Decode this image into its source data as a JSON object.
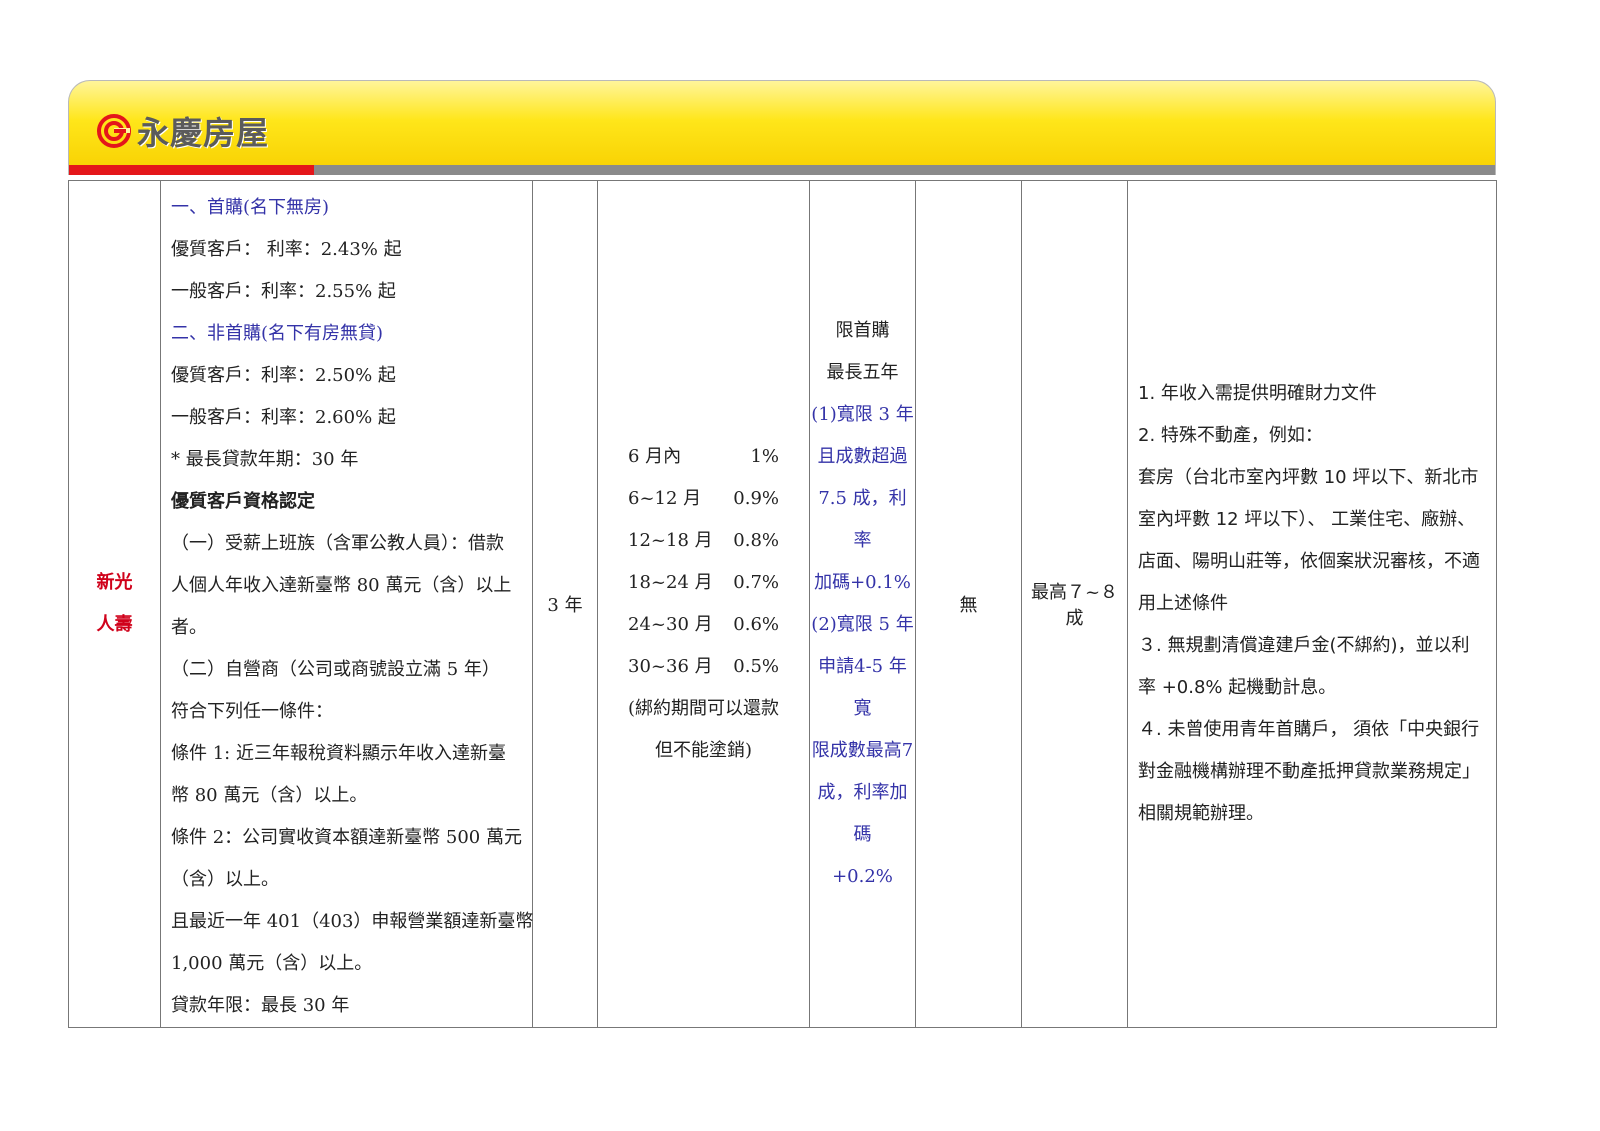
{
  "brand": {
    "name": "永慶房屋"
  },
  "table": {
    "company": [
      "新光",
      "人壽"
    ],
    "rate": {
      "first_title": "一、首購(名下無房)",
      "first_premium": "優質客戶： 利率：2.43% 起",
      "first_general": "一般客戶：利率：2.55% 起",
      "second_title": "二、非首購(名下有房無貸)",
      "second_premium": "優質客戶：利率：2.50% 起",
      "second_general": "一般客戶：利率：2.60% 起",
      "max_term": "* 最長貸款年期：30 年",
      "qual_title": "優質客戶資格認定",
      "q1_line1": "（一）受薪上班族（含軍公教人員）：借款",
      "q1_line2": "人個人年收入達新臺幣 80 萬元（含）以上",
      "q1_line3": "者。",
      "q2_line1": "（二）自營商（公司或商號設立滿 5 年）",
      "q2_line2": "符合下列任一條件：",
      "c1_line1": "條件 1: 近三年報稅資料顯示年收入達新臺",
      "c1_line2": "幣 80 萬元（含）以上。",
      "c2_line1": "條件 2：公司實收資本額達新臺幣 500 萬元",
      "c2_line2": "（含）以上。",
      "c3_line1": "且最近一年 401（403）申報營業額達新臺幣",
      "c3_line2": "1,000 萬元（含）以上。",
      "term": "貸款年限：最長 30 年"
    },
    "lock_period": "3 年",
    "penalty": {
      "rows": [
        {
          "period": "6 月內",
          "rate": "1%"
        },
        {
          "period": "6~12 月",
          "rate": "0.9%"
        },
        {
          "period": "12~18 月",
          "rate": "0.8%"
        },
        {
          "period": "18~24 月",
          "rate": "0.7%"
        },
        {
          "period": "24~30 月",
          "rate": "0.6%"
        },
        {
          "period": "30~36 月",
          "rate": "0.5%"
        }
      ],
      "note1": "(綁約期間可以還款",
      "note2": "但不能塗銷)"
    },
    "grace": {
      "l1": "限首購",
      "l2": "最長五年",
      "l3": "(1)寬限 3 年",
      "l4": "且成數超過",
      "l5": "7.5 成，利率",
      "l6": "加碼+0.1%",
      "l7": "(2)寬限 5 年",
      "l8": "申請4-5 年寬",
      "l9": "限成數最高7",
      "l10": "成，利率加碼",
      "l11": "+0.2%"
    },
    "fee": "無",
    "ltv": "最高７~８成",
    "notes": {
      "n1": "1. 年收入需提供明確財力文件",
      "n2": "2. 特殊不動產，例如：",
      "n3": "套房（台北市室內坪數 10 坪以下、新北市室內坪數 12 坪以下）、 工業住宅、廠辦、店面、陽明山莊等，依個案狀況審核，不適用上述條件",
      "n4": "３. 無規劃清償違建戶金(不綁約)，並以利率 +0.8% 起機動計息。",
      "n5": "４. 未曾使用青年首購戶， 須依「中央銀行對金融機構辦理不動產抵押貸款業務規定」相關規範辦理。"
    }
  },
  "colors": {
    "header_yellow": "#ffe61a",
    "accent_red": "#e4161a",
    "bar_gray": "#8a8a8a",
    "link_blue": "#3433a8"
  }
}
